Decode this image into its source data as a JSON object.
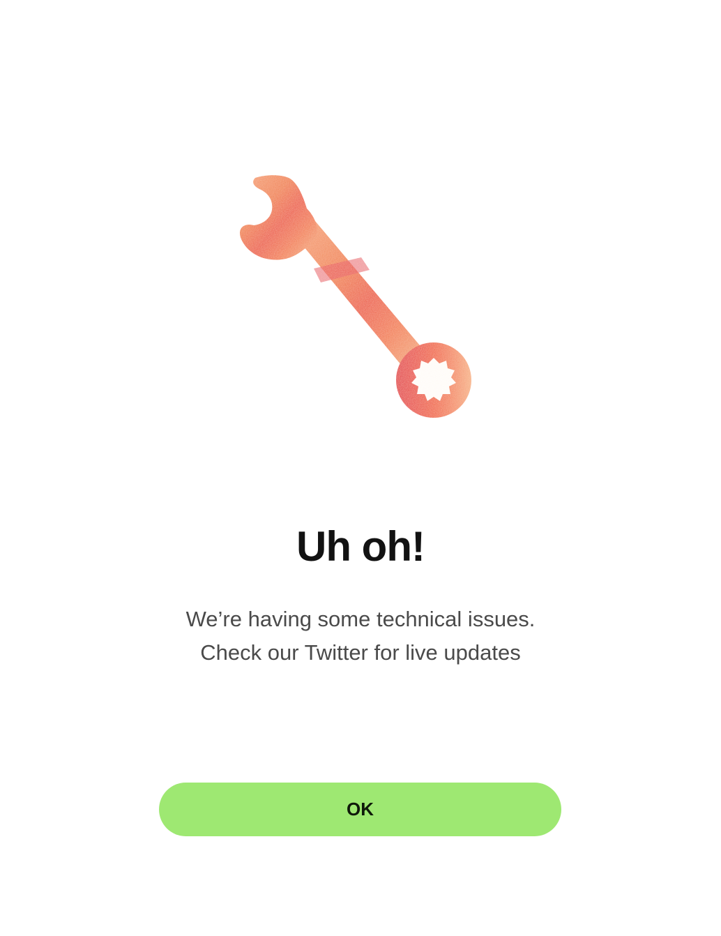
{
  "dialog": {
    "illustration_icon": "wrench-icon",
    "title": "Uh oh!",
    "message": "We’re having some technical issues. Check our Twitter for live updates",
    "ok_label": "OK"
  },
  "colors": {
    "background": "#ffffff",
    "title": "#121212",
    "message": "#4a4a4a",
    "button_bg": "#9ee872",
    "button_text": "#0f1a0a",
    "wrench_primary": "#f0603a",
    "wrench_light": "#f3a070",
    "wrench_dark": "#e0253e"
  }
}
